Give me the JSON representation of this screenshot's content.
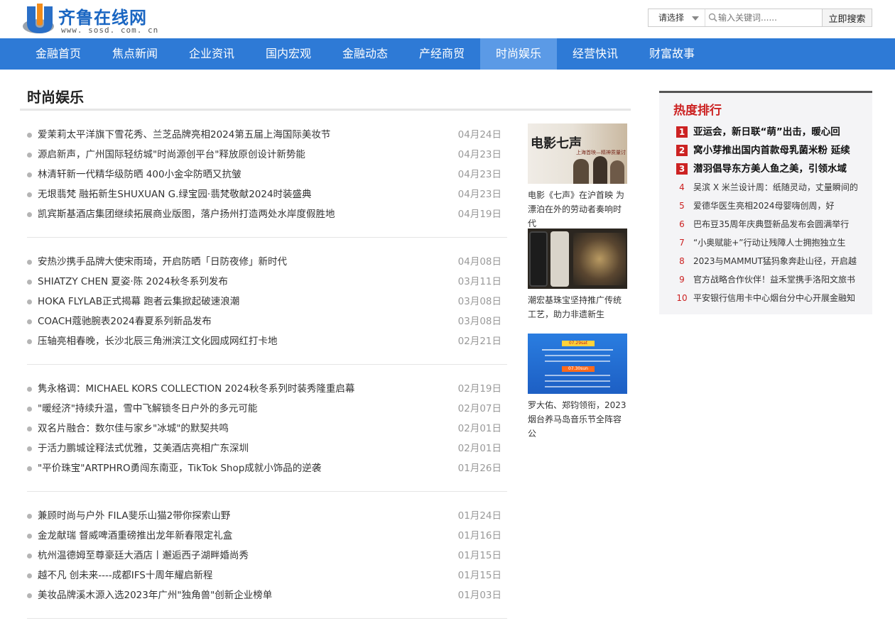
{
  "header": {
    "logo_text": "齐鲁在线网",
    "logo_url": "www. sosd. com. cn",
    "search": {
      "select_label": "请选择",
      "placeholder": "输入关键词......",
      "button_label": "立即搜索"
    }
  },
  "nav": {
    "items": [
      {
        "label": "金融首页"
      },
      {
        "label": "焦点新闻"
      },
      {
        "label": "企业资讯"
      },
      {
        "label": "国内宏观"
      },
      {
        "label": "金融动态"
      },
      {
        "label": "产经商贸"
      },
      {
        "label": "时尚娱乐"
      },
      {
        "label": "经营快讯"
      },
      {
        "label": "财富故事"
      }
    ],
    "active": "时尚娱乐"
  },
  "section": {
    "title": "时尚娱乐"
  },
  "news_groups": [
    [
      {
        "title": "爱茉莉太平洋旗下雪花秀、兰芝品牌亮相2024第五届上海国际美妆节",
        "date": "04月24日"
      },
      {
        "title": "源启新声，广州国际轻纺城\"时尚源创平台\"释放原创设计新势能",
        "date": "04月23日"
      },
      {
        "title": "林清轩新一代精华级防晒 400小金伞防晒又抗皱",
        "date": "04月23日"
      },
      {
        "title": "无垠翡梵 融拓新生SHUXUAN G.绿宝园·翡梵敬献2024时装盛典",
        "date": "04月23日"
      },
      {
        "title": "凯宾斯基酒店集团继续拓展商业版图，落户扬州打造两处水岸度假胜地",
        "date": "04月19日"
      }
    ],
    [
      {
        "title": "安热沙携手品牌大使宋雨琦，开启防晒「日防夜修」新时代",
        "date": "04月08日"
      },
      {
        "title": "SHIATZY CHEN 夏姿·陈 2024秋冬系列发布",
        "date": "03月11日"
      },
      {
        "title": "HOKA FLYLAB正式揭幕 跑者云集掀起破速浪潮",
        "date": "03月08日"
      },
      {
        "title": "COACH蔻驰腕表2024春夏系列新品发布",
        "date": "03月08日"
      },
      {
        "title": "压轴亮相春晚，长沙北辰三角洲滨江文化园成网红打卡地",
        "date": "02月21日"
      }
    ],
    [
      {
        "title": "隽永格调：MICHAEL KORS COLLECTION 2024秋冬系列时装秀隆重启幕",
        "date": "02月19日"
      },
      {
        "title": "\"暖经济\"持续升温，雪中飞解锁冬日户外的多元可能",
        "date": "02月07日"
      },
      {
        "title": "双名片融合：数尔佳与家乡\"冰城\"的默契共鸣",
        "date": "02月01日"
      },
      {
        "title": "于活力鹏城诠释法式优雅，艾美酒店亮相广东深圳",
        "date": "02月01日"
      },
      {
        "title": "\"平价珠宝\"ARTPHRO勇闯东南亚，TikTok Shop成就小饰品的逆袭",
        "date": "01月26日"
      }
    ],
    [
      {
        "title": "兼顾时尚与户外 FILA斐乐山猫2带你探索山野",
        "date": "01月24日"
      },
      {
        "title": "金龙献瑞 督威啤酒重磅推出龙年新春限定礼盒",
        "date": "01月16日"
      },
      {
        "title": "杭州温德姆至尊豪廷大酒店丨邂逅西子湖畔婚尚秀",
        "date": "01月15日"
      },
      {
        "title": "越不凡 创未来----成都IFS十周年耀启新程",
        "date": "01月15日"
      },
      {
        "title": "美妆品牌溪木源入选2023年广州\"独角兽\"创新企业榜单",
        "date": "01月03日"
      }
    ]
  ],
  "pics": [
    {
      "caption": "电影《七声》在沪首映 为漂泊在外的劳动者奏响时代",
      "image_text": "电影七声",
      "image_sub": "上海首映—精神质量讨论会"
    },
    {
      "caption": "潮宏基珠宝坚持推广传统工艺，助力非遗新生",
      "image_text": "",
      "image_sub": ""
    },
    {
      "caption": "罗大佑、郑钧领衔，2023烟台养马岛音乐节全阵容公",
      "image_text": "07.29sat",
      "image_sub": "07.30sun"
    }
  ],
  "sidebar": {
    "title": "热度排行",
    "items": [
      {
        "num": "1",
        "title": "亚运会，新日联“萌”出击，暖心回"
      },
      {
        "num": "2",
        "title": "窝小芽推出国内首款母乳菌米粉 延续"
      },
      {
        "num": "3",
        "title": "潜羽倡导东方美人鱼之美，引领水域"
      },
      {
        "num": "4",
        "title": "吴滨 X 米兰设计周：纸随灵动，丈量瞬间的"
      },
      {
        "num": "5",
        "title": "爱德华医生亮相2024母婴嗨创周，好"
      },
      {
        "num": "6",
        "title": "巴布豆35周年庆典暨新品发布会圆满举行"
      },
      {
        "num": "7",
        "title": "“小奥赋能+”行动让残障人士拥抱独立生"
      },
      {
        "num": "8",
        "title": "2023与MAMMUT猛犸象奔赴山径，开启越"
      },
      {
        "num": "9",
        "title": "官方战略合作伙伴！益禾堂携手洛阳文旅书"
      },
      {
        "num": "10",
        "title": "平安银行信用卡中心烟台分中心开展金融知"
      }
    ]
  },
  "colors": {
    "nav_bg": "#2e7ad6",
    "nav_active": "#5b9ae6",
    "rank_red": "#cc2222"
  }
}
